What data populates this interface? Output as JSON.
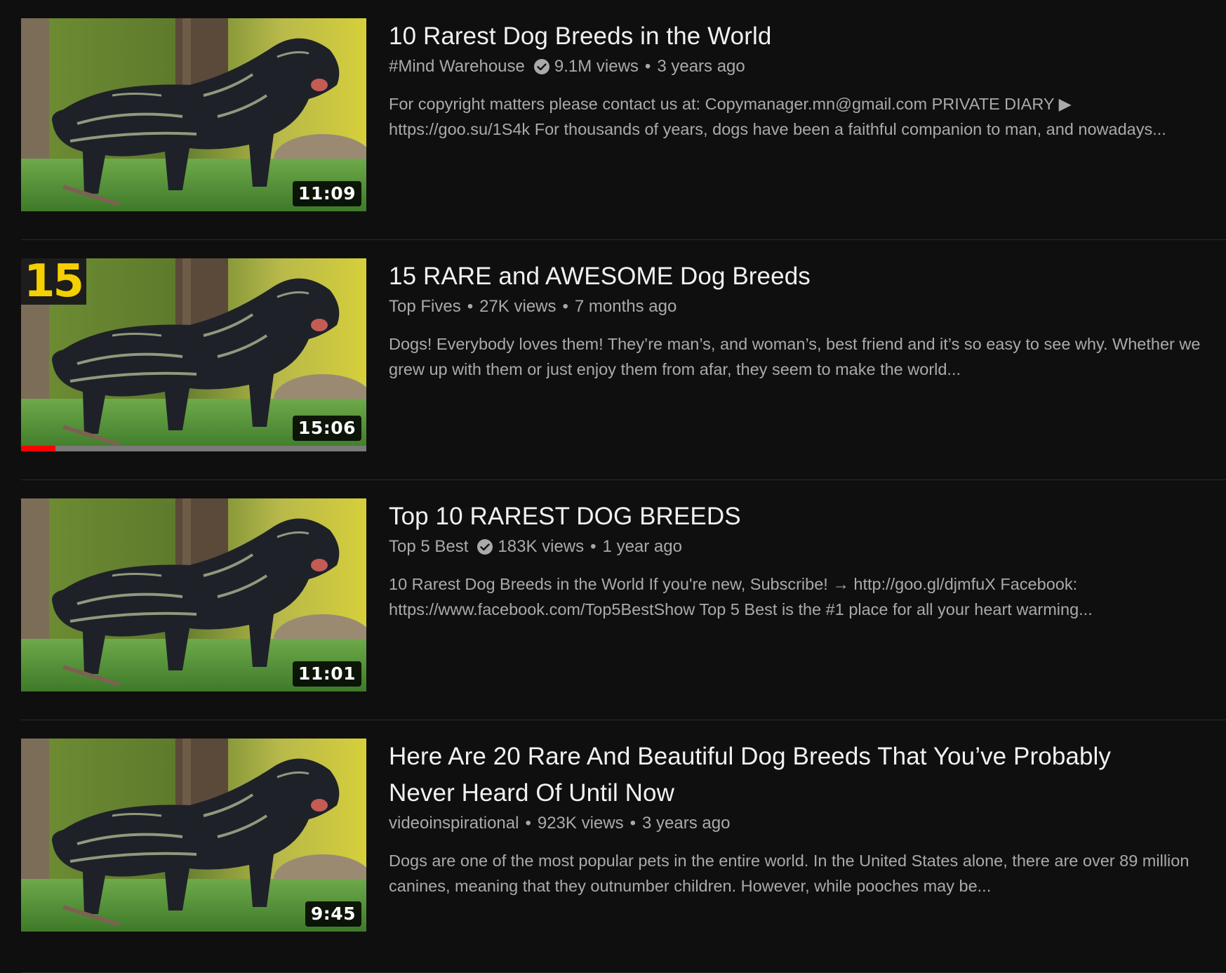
{
  "results": [
    {
      "title": "10 Rarest Dog Breeds in the World",
      "channel": "#Mind Warehouse",
      "verified": true,
      "views": "9.1M views",
      "age": "3 years ago",
      "description": "For copyright matters please contact us at: Copymanager.mn@gmail.com PRIVATE DIARY ▶\nhttps://goo.su/1S4k For thousands of years, dogs have been a faithful companion to man, and nowadays...",
      "duration": "11:09"
    },
    {
      "title": "15 RARE and AWESOME Dog Breeds",
      "channel": "Top Fives",
      "verified": false,
      "views": "27K views",
      "age": "7 months ago",
      "description": "Dogs! Everybody loves them! They’re man’s, and woman’s, best friend and it’s so easy to see why. Whether we\ngrew up with them or just enjoy them from afar, they seem to make the world...",
      "duration": "15:06",
      "corner_number": "15",
      "watch_progress": 0.1
    },
    {
      "title": "Top 10 RAREST DOG BREEDS",
      "channel": "Top 5 Best",
      "verified": true,
      "views": "183K views",
      "age": "1 year ago",
      "description": "10 Rarest Dog Breeds in the World If you're new, Subscribe! → http://goo.gl/djmfuX Facebook:\nhttps://www.facebook.com/Top5BestShow Top 5 Best is the #1 place for all your heart warming...",
      "duration": "11:01"
    },
    {
      "title": "Here Are 20 Rare And Beautiful Dog Breeds That You’ve Probably Never Heard Of Until Now",
      "channel": "videoinspirational",
      "verified": false,
      "views": "923K views",
      "age": "3 years ago",
      "description": "Dogs are one of the most popular pets in the entire world. In the United States alone, there are over 89 million\ncanines, meaning that they outnumber children. However, while pooches may be...",
      "duration": "9:45"
    }
  ],
  "separator": "•",
  "icons": {
    "verified": "verified-check-icon"
  },
  "colors": {
    "progress": "#ff0000",
    "background": "#0f0f0f",
    "corner_number": "#f5d000"
  }
}
